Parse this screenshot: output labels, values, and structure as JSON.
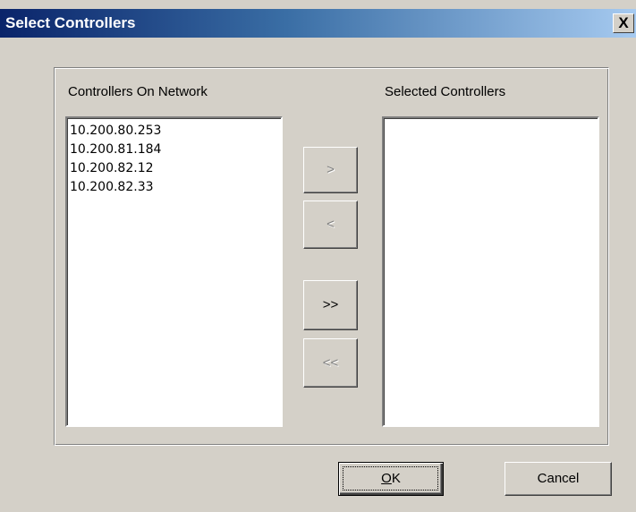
{
  "window": {
    "title": "Select Controllers",
    "close_glyph": "X"
  },
  "left_list": {
    "label": "Controllers On Network",
    "items": [
      "10.200.80.253",
      "10.200.81.184",
      "10.200.82.12",
      "10.200.82.33"
    ]
  },
  "right_list": {
    "label": "Selected Controllers",
    "items": []
  },
  "transfer_buttons": {
    "add": ">",
    "remove": "<",
    "add_all": ">>",
    "remove_all": "<<"
  },
  "footer": {
    "ok_accel": "O",
    "ok_rest": "K",
    "cancel": "Cancel"
  },
  "colors": {
    "title_gradient_start": "#0a246a",
    "title_gradient_end": "#a6caf0",
    "dialog_face": "#d4d0c8",
    "disabled_text": "#808080"
  }
}
